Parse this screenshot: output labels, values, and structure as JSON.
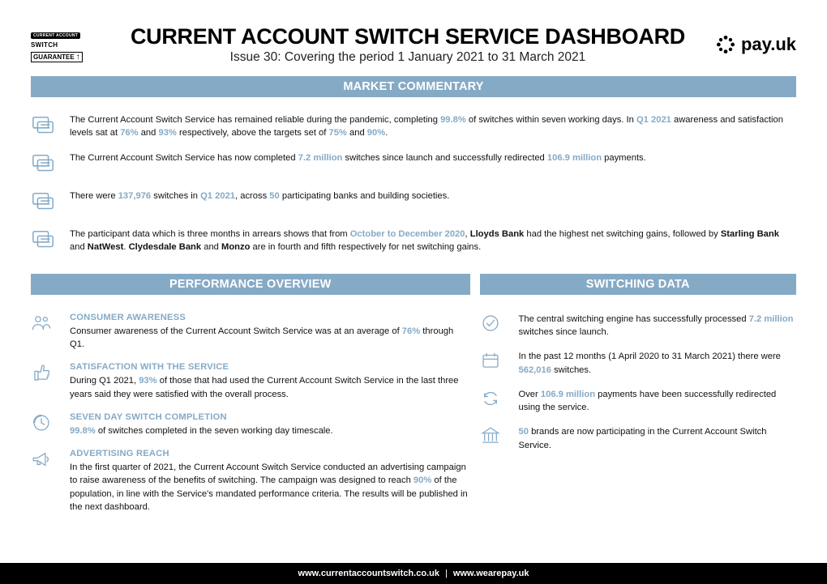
{
  "logos": {
    "switch_top": "CURRENT ACCOUNT",
    "switch_mid": "SWITCH",
    "switch_bot": "GUARANTEE",
    "payuk": "pay.uk"
  },
  "header": {
    "title": "CURRENT ACCOUNT SWITCH SERVICE DASHBOARD",
    "subtitle": "Issue 30: Covering the period 1 January 2021 to 31 March 2021"
  },
  "sections": {
    "commentary": "MARKET COMMENTARY",
    "performance": "PERFORMANCE OVERVIEW",
    "switching": "SWITCHING DATA"
  },
  "commentary": [
    {
      "pre": "The Current Account Switch Service has remained reliable during the pandemic, completing ",
      "h1": "99.8%",
      "mid1": " of switches within seven working days. In ",
      "h2": "Q1 2021",
      "mid2": " awareness and satisfaction levels sat at ",
      "h3": "76%",
      "mid3": " and ",
      "h4": "93%",
      "mid4": " respectively, above the targets set of ",
      "h5": "75%",
      "mid5": " and ",
      "h6": "90%",
      "post": "."
    },
    {
      "pre": "The Current Account Switch Service has now completed ",
      "h1": "7.2 million",
      "mid1": " switches since launch and successfully redirected ",
      "h2": "106.9 million",
      "post": " payments."
    },
    {
      "pre": "There were ",
      "h1": "137,976",
      "mid1": " switches in ",
      "h2": "Q1 2021",
      "mid2": ", across ",
      "h3": "50",
      "post": " participating banks and building societies."
    },
    {
      "pre": "The participant data which is three months in arrears shows that from ",
      "h1": "October to December 2020",
      "mid1": ", ",
      "b1": "Lloyds Bank",
      "mid2": " had the highest net switching gains, followed by ",
      "b2": "Starling Bank",
      "mid3": " and ",
      "b3": "NatWest",
      "mid4": ". ",
      "b4": "Clydesdale Bank",
      "mid5": " and ",
      "b5": "Monzo",
      "post": " are in fourth and fifth respectively for net switching gains."
    }
  ],
  "performance": {
    "awareness": {
      "title": "CONSUMER AWARENESS",
      "pre": "Consumer awareness of the Current Account Switch Service was at an average of ",
      "h1": "76%",
      "post": " through Q1."
    },
    "satisfaction": {
      "title": "SATISFACTION WITH THE SERVICE",
      "pre": "During Q1 2021, ",
      "h1": "93%",
      "post": " of those that had used the Current Account Switch Service in the last three years said they were satisfied with the overall process."
    },
    "sevenday": {
      "title": "SEVEN DAY SWITCH COMPLETION",
      "h1": "99.8%",
      "post": " of switches completed in the seven working day timescale."
    },
    "advertising": {
      "title": "ADVERTISING REACH",
      "pre": "In the first quarter of 2021, the Current Account Switch Service conducted an advertising campaign to raise awareness of the benefits of switching. The campaign was designed to reach ",
      "h1": "90%",
      "post": " of the population, in line with the Service's mandated performance criteria. The results will be published in the next dashboard."
    }
  },
  "switching": {
    "processed": {
      "pre": "The central switching engine has successfully processed ",
      "h1": "7.2 million",
      "post": " switches since launch."
    },
    "past12": {
      "pre": "In the past 12 months (1 April 2020 to 31 March 2021) there were ",
      "h1": "562,016",
      "post": " switches."
    },
    "payments": {
      "pre": "Over ",
      "h1": "106.9 million",
      "post": " payments have been successfully redirected using the service."
    },
    "brands": {
      "h1": "50",
      "post": " brands are now participating in the Current Account Switch Service."
    }
  },
  "footer": {
    "url1": "www.currentaccountswitch.co.uk",
    "url2": "www.wearepay.uk"
  }
}
